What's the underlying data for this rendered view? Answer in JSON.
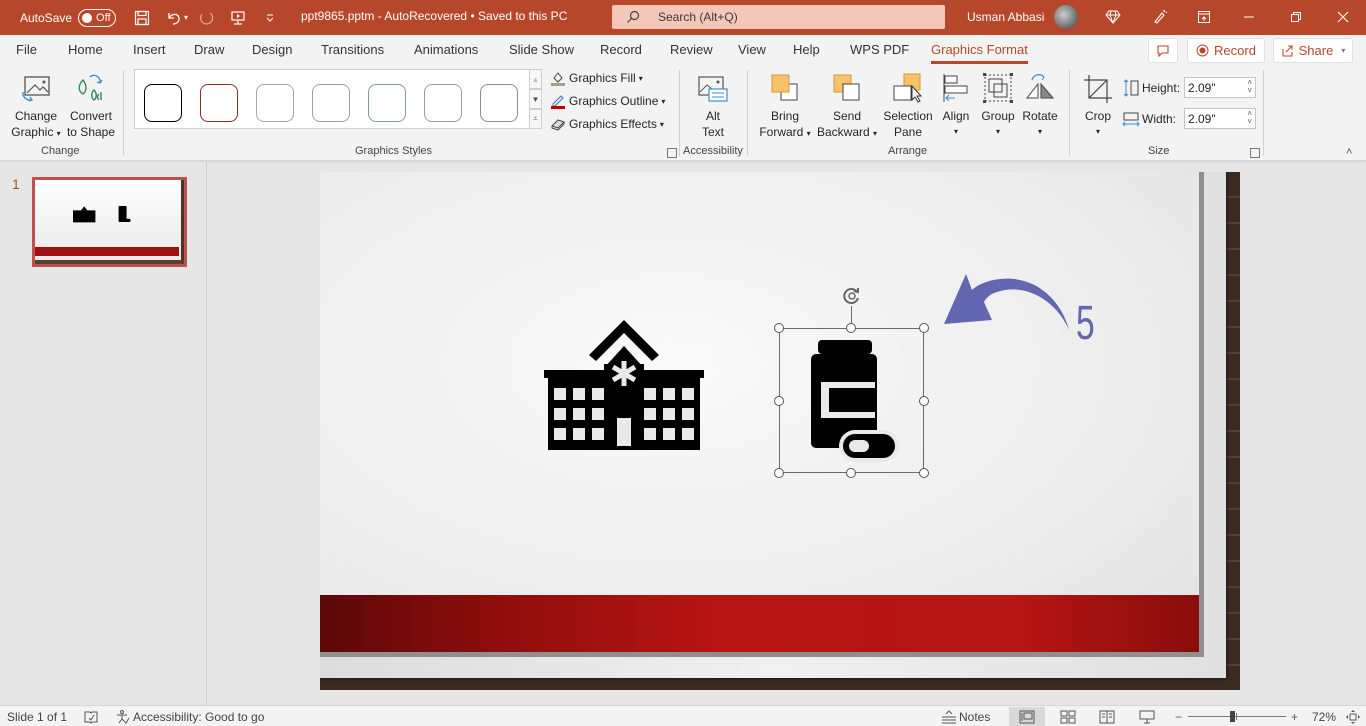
{
  "titlebar": {
    "autosave_label": "AutoSave",
    "autosave_state": "Off",
    "document_title": "ppt9865.pptm  -  AutoRecovered  •  Saved to this PC",
    "search_placeholder": "Search (Alt+Q)",
    "user_name": "Usman Abbasi",
    "accent_color": "#b7472a"
  },
  "tabs": [
    {
      "label": "File"
    },
    {
      "label": "Home"
    },
    {
      "label": "Insert"
    },
    {
      "label": "Draw"
    },
    {
      "label": "Design"
    },
    {
      "label": "Transitions"
    },
    {
      "label": "Animations"
    },
    {
      "label": "Slide Show"
    },
    {
      "label": "Record"
    },
    {
      "label": "Review"
    },
    {
      "label": "View"
    },
    {
      "label": "Help"
    },
    {
      "label": "WPS PDF"
    },
    {
      "label": "Graphics Format",
      "active": true
    }
  ],
  "tab_actions": {
    "record_label": "Record",
    "share_label": "Share"
  },
  "ribbon": {
    "change_group": {
      "label": "Change",
      "change_graphic_line1": "Change",
      "change_graphic_line2": "Graphic",
      "convert_line1": "Convert",
      "convert_line2": "to Shape"
    },
    "styles_group": {
      "label": "Graphics Styles",
      "swatch_colors": [
        "#000000",
        "#8b2b2b",
        "#a8a8a0",
        "#9aa39a",
        "#7f9aa0",
        "#9a9aa8",
        "#8c8c8c"
      ],
      "fill_label": "Graphics Fill",
      "outline_label": "Graphics Outline",
      "effects_label": "Graphics Effects"
    },
    "accessibility_group": {
      "label": "Accessibility",
      "alt_text_line1": "Alt",
      "alt_text_line2": "Text"
    },
    "arrange_group": {
      "label": "Arrange",
      "bring_forward_line1": "Bring",
      "bring_forward_line2": "Forward",
      "send_backward_line1": "Send",
      "send_backward_line2": "Backward",
      "selection_pane_line1": "Selection",
      "selection_pane_line2": "Pane",
      "align_label": "Align",
      "group_label": "Group",
      "rotate_label": "Rotate"
    },
    "size_group": {
      "label": "Size",
      "crop_label": "Crop",
      "height_label": "Height:",
      "height_value": "2.09\"",
      "width_label": "Width:",
      "width_value": "2.09\""
    }
  },
  "thumbnails": [
    {
      "number": "1"
    }
  ],
  "slide": {
    "annotation_number": "5",
    "annotation_color": "#6366b0",
    "icons": [
      "hospital-icon",
      "medicine-bottle-icon"
    ],
    "selected_icon": "medicine-bottle-icon"
  },
  "statusbar": {
    "slide_info": "Slide 1 of 1",
    "accessibility": "Accessibility: Good to go",
    "notes_label": "Notes",
    "zoom_level": "72%",
    "zoom_fraction": 0.45
  }
}
